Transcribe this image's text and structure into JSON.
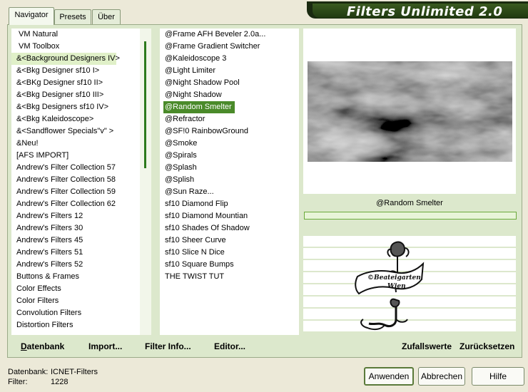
{
  "title": "Filters Unlimited 2.0",
  "tabs": [
    {
      "label": "Navigator"
    },
    {
      "label": "Presets"
    },
    {
      "label": "Über"
    }
  ],
  "categories": [
    "VM Natural",
    "VM Toolbox",
    "&<Background Designers IV>",
    "&<Bkg Designer sf10 I>",
    "&<BKg Designer sf10 II>",
    "&<Bkg Designer sf10 III>",
    "&<Bkg Designers sf10 IV>",
    "&<Bkg Kaleidoscope>",
    "&<Sandflower Specials\"v\" >",
    "&Neu!",
    "[AFS IMPORT]",
    "Andrew's Filter Collection 57",
    "Andrew's Filter Collection 58",
    "Andrew's Filter Collection 59",
    "Andrew's Filter Collection 62",
    "Andrew's Filters 12",
    "Andrew's Filters 30",
    "Andrew's Filters 45",
    "Andrew's Filters 51",
    "Andrew's Filters 52",
    "Buttons & Frames",
    "Color Effects",
    "Color Filters",
    "Convolution Filters",
    "Distortion Filters"
  ],
  "selected_category": "&<Background Designers IV>",
  "filters": [
    "@Frame AFH Beveler 2.0a...",
    "@Frame Gradient Switcher",
    "@Kaleidoscope 3",
    "@Light Limiter",
    "@Night Shadow Pool",
    "@Night Shadow",
    "@Random Smelter",
    "@Refractor",
    "@SF!0 RainbowGround",
    "@Smoke",
    "@Spirals",
    "@Splash",
    "@Splish",
    "@Sun Raze...",
    "sf10 Diamond Flip",
    "sf10 Diamond Mountian",
    "sf10 Shades Of Shadow",
    "sf10 Sheer Curve",
    "sf10 Slice N Dice",
    "sf10 Square Bumps",
    "THE TWIST TUT"
  ],
  "selected_filter": "@Random Smelter",
  "preview_filter_name": "@Random Smelter",
  "watermark": "©Beateigarten Wien",
  "left_actions": {
    "datenbank": "Datenbank",
    "import": "Import...",
    "filter_info": "Filter Info...",
    "editor": "Editor..."
  },
  "right_actions": {
    "zufallswerte": "Zufallswerte",
    "zuruecksetzen": "Zurücksetzen"
  },
  "status": {
    "db_label": "Datenbank:",
    "db_value": "ICNET-Filters",
    "filter_label": "Filter:",
    "filter_value": "1228"
  },
  "buttons": {
    "apply": "Anwenden",
    "cancel": "Abbrechen",
    "help": "Hilfe"
  },
  "colors": {
    "accent": "#4a8a2a",
    "selection_light": "#e0f0c8",
    "panel": "#dce8cc"
  }
}
